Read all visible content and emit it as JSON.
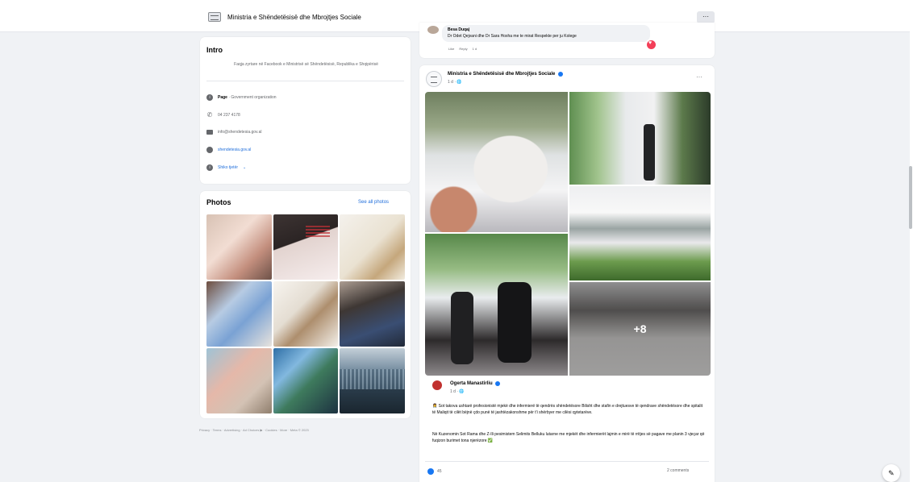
{
  "header": {
    "page_title": "Ministria e Shëndetësisë dhe Mbrojtjes Sociale",
    "more_label": "···"
  },
  "intro": {
    "title": "Intro",
    "description": "Faqja zyrtare në Facebook e Ministrisë së Shëndetësisë, Republika e Shqipërisë",
    "items": [
      {
        "icon": "info-icon",
        "bold": "Page",
        "text": " · Government organization"
      },
      {
        "icon": "phone-icon",
        "text": "04 237 4178"
      },
      {
        "icon": "email-icon",
        "text": "info@shendetesia.gov.al"
      },
      {
        "icon": "globe-icon",
        "text": "shendetesia.gov.al"
      },
      {
        "icon": "info-icon",
        "text": "Shiko tjetër"
      }
    ]
  },
  "photos": {
    "title": "Photos",
    "see_all": "See all photos"
  },
  "footer": {
    "links": "Privacy · Terms · Advertising · Ad Choices ▶ · Cookies · More · Meta © 2023"
  },
  "comment": {
    "author": "Besa Duqaj",
    "text": "Dr Odet Qejvani dhe Dr Sara Hoxha me te mirat Respekte per ju Kolege",
    "actions": [
      "Like",
      "Reply",
      "1 d"
    ]
  },
  "post": {
    "author": "Ministria e Shëndetësisë dhe Mbrojtjes Sociale",
    "meta": "1 d · 🌐",
    "more": "···",
    "collage_more": "+8",
    "shared": {
      "author": "Ogerta Manastirliu",
      "meta": "1 d · 🌐",
      "body_1": "👩‍⚕️ Sot takova ushtarë profesionistë mjekë dhe infermierë të qendrës shëndetësore Bilisht dhe stafin e drejtuesve të qendrave shëndetësore dhe spitalit të Maliqit të cilët bëjnë çdo punë të jashtëzakonshme për t'i shërbyer me cilësi qytetarëve.",
      "link": "Bilisht",
      "body_2": "Në Kuzenomin Sot Rama dhe Z-Ili pesimistem Selimits Belluku lutarne me mjekët dhe infermierët lajmin e mirë të rritjes së pagave me planin 3 vjeçar që fuqizon burimet tona njerëzore ✅"
    },
    "reactions": "45",
    "comments": "2 comments"
  },
  "colors": {
    "brand": "#1877f2",
    "link": "#216fdb",
    "background": "#f0f2f5"
  }
}
